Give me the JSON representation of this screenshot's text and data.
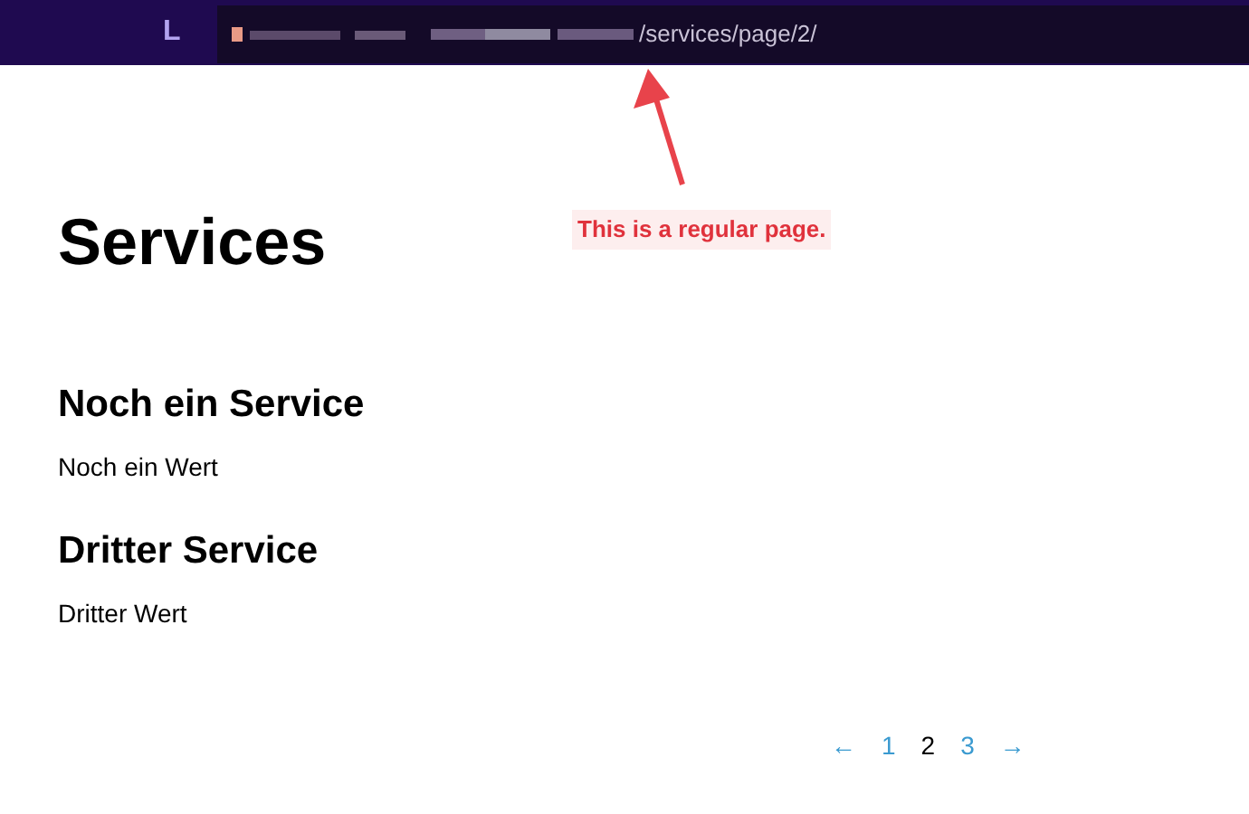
{
  "browser": {
    "logo": "L",
    "url": "/services/page/2/"
  },
  "annotation": {
    "text": "This is a regular page."
  },
  "page": {
    "title": "Services",
    "services": [
      {
        "name": "Noch ein Service",
        "value": "Noch ein Wert"
      },
      {
        "name": "Dritter Service",
        "value": "Dritter Wert"
      }
    ]
  },
  "pagination": {
    "prev": "←",
    "next": "→",
    "pages": [
      {
        "label": "1",
        "selected": false
      },
      {
        "label": "2",
        "selected": true
      },
      {
        "label": "3",
        "selected": false
      }
    ]
  }
}
